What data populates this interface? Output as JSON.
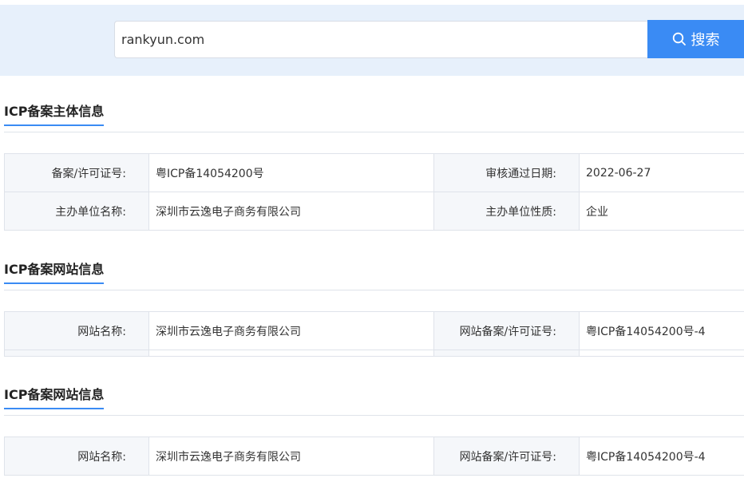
{
  "search": {
    "value": "rankyun.com",
    "button_label": "搜索"
  },
  "section1": {
    "title": "ICP备案主体信息",
    "rows": [
      [
        "备案/许可证号:",
        "粤ICP备14054200号",
        "审核通过日期:",
        "2022-06-27"
      ],
      [
        "主办单位名称:",
        "深圳市云逸电子商务有限公司",
        "主办单位性质:",
        "企业"
      ]
    ]
  },
  "section2": {
    "title": "ICP备案网站信息",
    "rows": [
      [
        "网站名称:",
        "深圳市云逸电子商务有限公司",
        "网站备案/许可证号:",
        "粤ICP备14054200号-4"
      ]
    ]
  },
  "section3": {
    "title": "ICP备案网站信息",
    "rows": [
      [
        "网站名称:",
        "深圳市云逸电子商务有限公司",
        "网站备案/许可证号:",
        "粤ICP备14054200号-4"
      ]
    ]
  }
}
